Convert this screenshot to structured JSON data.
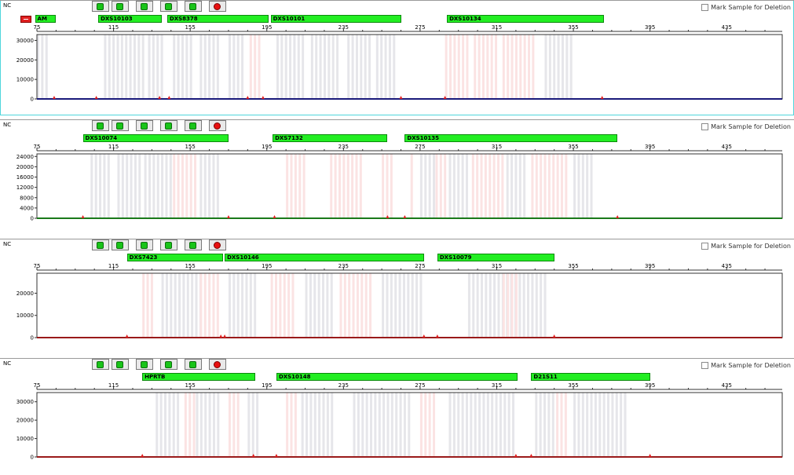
{
  "axis_ticks": [
    "75",
    "115",
    "155",
    "195",
    "235",
    "275",
    "315",
    "355",
    "395",
    "435"
  ],
  "mark_label": "Mark Sample for Deletion",
  "colors": {
    "marker": "#22ee22",
    "panel_select": "#4fd6dc",
    "peak_red": "#e02020"
  },
  "panels": [
    {
      "sample": "NC",
      "selected": true,
      "toolbar": [
        "green-square-icon",
        "green-square-icon",
        "green-square-icon",
        "green-square-icon",
        "green-square-icon",
        "stop-icon"
      ],
      "has_delete_marker": true,
      "markers": [
        {
          "label": "AM",
          "from": 74,
          "to": 85
        },
        {
          "label": "DXS10103",
          "from": 107,
          "to": 140
        },
        {
          "label": "DXS8378",
          "from": 143,
          "to": 196
        },
        {
          "label": "DXS10101",
          "from": 197,
          "to": 265
        },
        {
          "label": "DXS10134",
          "from": 289,
          "to": 371
        }
      ],
      "y_ticks": [
        "30000",
        "20000",
        "10000",
        "0"
      ],
      "y_max": 33000,
      "baseline_color": "#1a1a7a",
      "peaks": [
        84,
        106,
        139,
        144,
        185,
        193,
        265,
        288,
        370
      ],
      "bins_gray": [
        [
          75,
          80
        ],
        [
          110,
          130
        ],
        [
          133,
          140
        ],
        [
          146,
          155
        ],
        [
          160,
          170
        ],
        [
          175,
          182
        ],
        [
          200,
          215
        ],
        [
          218,
          233
        ],
        [
          237,
          250
        ],
        [
          252,
          262
        ],
        [
          340,
          355
        ]
      ],
      "bins_red": [
        [
          186,
          192
        ],
        [
          288,
          300
        ],
        [
          303,
          315
        ],
        [
          318,
          335
        ]
      ]
    },
    {
      "sample": "NC",
      "selected": false,
      "toolbar": [
        "green-square-icon",
        "green-square-icon",
        "green-square-icon",
        "green-square-icon",
        "green-square-icon",
        "stop-icon"
      ],
      "has_delete_marker": false,
      "markers": [
        {
          "label": "DXS10074",
          "from": 99,
          "to": 175
        },
        {
          "label": "DXS7132",
          "from": 198,
          "to": 258
        },
        {
          "label": "DXS10135",
          "from": 267,
          "to": 378
        }
      ],
      "y_ticks": [
        "24000",
        "20000",
        "16000",
        "12000",
        "8000",
        "4000",
        "0"
      ],
      "y_max": 25000,
      "baseline_color": "#1a7a1a",
      "peaks": [
        99,
        175,
        199,
        258,
        267,
        378
      ],
      "bins_gray": [
        [
          103,
          112
        ],
        [
          117,
          128
        ],
        [
          131,
          145
        ],
        [
          160,
          170
        ],
        [
          275,
          282
        ],
        [
          290,
          300
        ],
        [
          320,
          330
        ],
        [
          355,
          365
        ]
      ],
      "bins_red": [
        [
          146,
          158
        ],
        [
          205,
          215
        ],
        [
          228,
          245
        ],
        [
          255,
          260
        ],
        [
          270,
          272
        ],
        [
          283,
          288
        ],
        [
          302,
          318
        ],
        [
          333,
          352
        ]
      ]
    },
    {
      "sample": "NC",
      "selected": false,
      "toolbar": [
        "green-square-icon",
        "green-square-icon",
        "green-square-icon",
        "green-square-icon",
        "green-square-icon",
        "stop-icon"
      ],
      "has_delete_marker": false,
      "markers": [
        {
          "label": "DXS7423",
          "from": 122,
          "to": 172
        },
        {
          "label": "DXS10146",
          "from": 173,
          "to": 277
        },
        {
          "label": "DXS10079",
          "from": 284,
          "to": 345
        }
      ],
      "y_ticks": [
        "20000",
        "10000",
        "0"
      ],
      "y_max": 29000,
      "baseline_color": "#9a1a1a",
      "peaks": [
        122,
        171,
        173,
        277,
        284,
        345
      ],
      "bins_gray": [
        [
          140,
          160
        ],
        [
          175,
          190
        ],
        [
          215,
          230
        ],
        [
          255,
          275
        ],
        [
          300,
          340
        ]
      ],
      "bins_red": [
        [
          130,
          135
        ],
        [
          160,
          170
        ],
        [
          197,
          210
        ],
        [
          233,
          250
        ],
        [
          318,
          326
        ]
      ]
    },
    {
      "sample": "NC",
      "selected": false,
      "toolbar": [
        "green-square-icon",
        "green-square-icon",
        "green-square-icon",
        "green-square-icon",
        "green-square-icon",
        "stop-icon"
      ],
      "has_delete_marker": false,
      "markers": [
        {
          "label": "HPRTB",
          "from": 130,
          "to": 189
        },
        {
          "label": "DXS10148",
          "from": 200,
          "to": 326
        },
        {
          "label": "DXS10148 ",
          "from": 200,
          "to": 326
        },
        {
          "label": "D21S11",
          "from": 333,
          "to": 395
        }
      ],
      "y_ticks": [
        "30000",
        "20000",
        "10000",
        "0"
      ],
      "y_max": 35000,
      "baseline_color": "#9a1a1a",
      "peaks": [
        130,
        188,
        200,
        325,
        333,
        395
      ],
      "bins_gray": [
        [
          137,
          150
        ],
        [
          158,
          170
        ],
        [
          185,
          190
        ],
        [
          213,
          230
        ],
        [
          240,
          270
        ],
        [
          290,
          325
        ],
        [
          335,
          345
        ],
        [
          355,
          382
        ]
      ],
      "bins_red": [
        [
          152,
          157
        ],
        [
          175,
          180
        ],
        [
          205,
          210
        ],
        [
          275,
          282
        ],
        [
          346,
          352
        ]
      ]
    }
  ]
}
